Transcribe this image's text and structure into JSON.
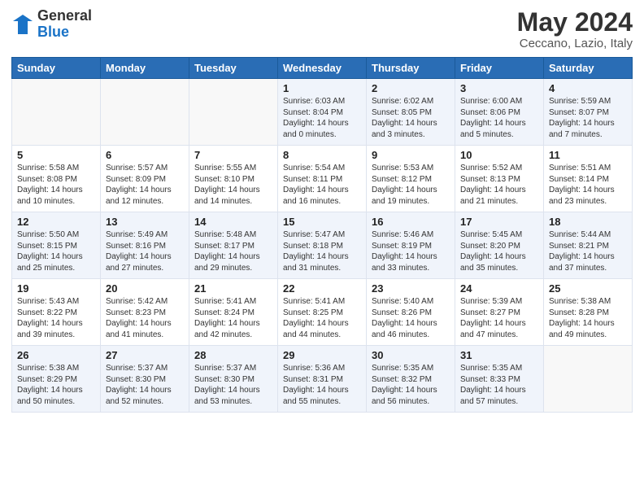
{
  "logo": {
    "general": "General",
    "blue": "Blue"
  },
  "title": {
    "month": "May 2024",
    "location": "Ceccano, Lazio, Italy"
  },
  "days_header": [
    "Sunday",
    "Monday",
    "Tuesday",
    "Wednesday",
    "Thursday",
    "Friday",
    "Saturday"
  ],
  "weeks": [
    [
      {
        "num": "",
        "content": ""
      },
      {
        "num": "",
        "content": ""
      },
      {
        "num": "",
        "content": ""
      },
      {
        "num": "1",
        "content": "Sunrise: 6:03 AM\nSunset: 8:04 PM\nDaylight: 14 hours\nand 0 minutes."
      },
      {
        "num": "2",
        "content": "Sunrise: 6:02 AM\nSunset: 8:05 PM\nDaylight: 14 hours\nand 3 minutes."
      },
      {
        "num": "3",
        "content": "Sunrise: 6:00 AM\nSunset: 8:06 PM\nDaylight: 14 hours\nand 5 minutes."
      },
      {
        "num": "4",
        "content": "Sunrise: 5:59 AM\nSunset: 8:07 PM\nDaylight: 14 hours\nand 7 minutes."
      }
    ],
    [
      {
        "num": "5",
        "content": "Sunrise: 5:58 AM\nSunset: 8:08 PM\nDaylight: 14 hours\nand 10 minutes."
      },
      {
        "num": "6",
        "content": "Sunrise: 5:57 AM\nSunset: 8:09 PM\nDaylight: 14 hours\nand 12 minutes."
      },
      {
        "num": "7",
        "content": "Sunrise: 5:55 AM\nSunset: 8:10 PM\nDaylight: 14 hours\nand 14 minutes."
      },
      {
        "num": "8",
        "content": "Sunrise: 5:54 AM\nSunset: 8:11 PM\nDaylight: 14 hours\nand 16 minutes."
      },
      {
        "num": "9",
        "content": "Sunrise: 5:53 AM\nSunset: 8:12 PM\nDaylight: 14 hours\nand 19 minutes."
      },
      {
        "num": "10",
        "content": "Sunrise: 5:52 AM\nSunset: 8:13 PM\nDaylight: 14 hours\nand 21 minutes."
      },
      {
        "num": "11",
        "content": "Sunrise: 5:51 AM\nSunset: 8:14 PM\nDaylight: 14 hours\nand 23 minutes."
      }
    ],
    [
      {
        "num": "12",
        "content": "Sunrise: 5:50 AM\nSunset: 8:15 PM\nDaylight: 14 hours\nand 25 minutes."
      },
      {
        "num": "13",
        "content": "Sunrise: 5:49 AM\nSunset: 8:16 PM\nDaylight: 14 hours\nand 27 minutes."
      },
      {
        "num": "14",
        "content": "Sunrise: 5:48 AM\nSunset: 8:17 PM\nDaylight: 14 hours\nand 29 minutes."
      },
      {
        "num": "15",
        "content": "Sunrise: 5:47 AM\nSunset: 8:18 PM\nDaylight: 14 hours\nand 31 minutes."
      },
      {
        "num": "16",
        "content": "Sunrise: 5:46 AM\nSunset: 8:19 PM\nDaylight: 14 hours\nand 33 minutes."
      },
      {
        "num": "17",
        "content": "Sunrise: 5:45 AM\nSunset: 8:20 PM\nDaylight: 14 hours\nand 35 minutes."
      },
      {
        "num": "18",
        "content": "Sunrise: 5:44 AM\nSunset: 8:21 PM\nDaylight: 14 hours\nand 37 minutes."
      }
    ],
    [
      {
        "num": "19",
        "content": "Sunrise: 5:43 AM\nSunset: 8:22 PM\nDaylight: 14 hours\nand 39 minutes."
      },
      {
        "num": "20",
        "content": "Sunrise: 5:42 AM\nSunset: 8:23 PM\nDaylight: 14 hours\nand 41 minutes."
      },
      {
        "num": "21",
        "content": "Sunrise: 5:41 AM\nSunset: 8:24 PM\nDaylight: 14 hours\nand 42 minutes."
      },
      {
        "num": "22",
        "content": "Sunrise: 5:41 AM\nSunset: 8:25 PM\nDaylight: 14 hours\nand 44 minutes."
      },
      {
        "num": "23",
        "content": "Sunrise: 5:40 AM\nSunset: 8:26 PM\nDaylight: 14 hours\nand 46 minutes."
      },
      {
        "num": "24",
        "content": "Sunrise: 5:39 AM\nSunset: 8:27 PM\nDaylight: 14 hours\nand 47 minutes."
      },
      {
        "num": "25",
        "content": "Sunrise: 5:38 AM\nSunset: 8:28 PM\nDaylight: 14 hours\nand 49 minutes."
      }
    ],
    [
      {
        "num": "26",
        "content": "Sunrise: 5:38 AM\nSunset: 8:29 PM\nDaylight: 14 hours\nand 50 minutes."
      },
      {
        "num": "27",
        "content": "Sunrise: 5:37 AM\nSunset: 8:30 PM\nDaylight: 14 hours\nand 52 minutes."
      },
      {
        "num": "28",
        "content": "Sunrise: 5:37 AM\nSunset: 8:30 PM\nDaylight: 14 hours\nand 53 minutes."
      },
      {
        "num": "29",
        "content": "Sunrise: 5:36 AM\nSunset: 8:31 PM\nDaylight: 14 hours\nand 55 minutes."
      },
      {
        "num": "30",
        "content": "Sunrise: 5:35 AM\nSunset: 8:32 PM\nDaylight: 14 hours\nand 56 minutes."
      },
      {
        "num": "31",
        "content": "Sunrise: 5:35 AM\nSunset: 8:33 PM\nDaylight: 14 hours\nand 57 minutes."
      },
      {
        "num": "",
        "content": ""
      }
    ]
  ]
}
